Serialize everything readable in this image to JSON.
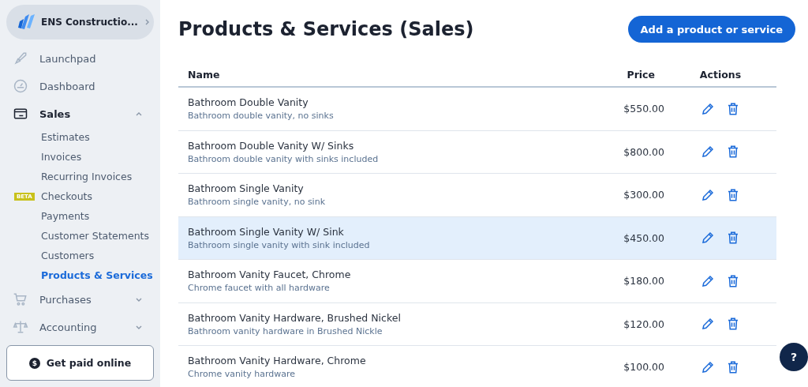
{
  "company": {
    "name": "ENS Constructio..."
  },
  "nav": [
    {
      "label": "Launchpad"
    },
    {
      "label": "Dashboard"
    },
    {
      "label": "Sales",
      "expanded": true,
      "children": [
        {
          "label": "Estimates",
          "selected": false
        },
        {
          "label": "Invoices",
          "selected": false
        },
        {
          "label": "Recurring Invoices",
          "selected": false
        },
        {
          "label": "Checkouts",
          "selected": false,
          "badge": "BETA"
        },
        {
          "label": "Payments",
          "selected": false
        },
        {
          "label": "Customer Statements",
          "selected": false
        },
        {
          "label": "Customers",
          "selected": false
        },
        {
          "label": "Products & Services",
          "selected": true
        }
      ]
    },
    {
      "label": "Purchases",
      "expanded": false
    },
    {
      "label": "Accounting",
      "expanded": false
    }
  ],
  "get_paid": {
    "label": "Get paid online",
    "icon": "$"
  },
  "title": "Products & Services (Sales)",
  "add_button": "Add a product or service",
  "table": {
    "columns": [
      "Name",
      "Price",
      "Actions"
    ],
    "rows": [
      {
        "name": "Bathroom Double Vanity",
        "description": "Bathroom double vanity, no sinks",
        "price": "$550.00",
        "selected": false
      },
      {
        "name": "Bathroom Double Vanity W/ Sinks",
        "description": "Bathroom double vanity with sinks included",
        "price": "$800.00",
        "selected": false
      },
      {
        "name": "Bathroom Single Vanity",
        "description": "Bathroom single vanity, no sink",
        "price": "$300.00",
        "selected": false
      },
      {
        "name": "Bathroom Single Vanity W/ Sink",
        "description": "Bathroom single vanity with sink included",
        "price": "$450.00",
        "selected": true
      },
      {
        "name": "Bathroom Vanity Faucet, Chrome",
        "description": "Chrome faucet with all hardware",
        "price": "$180.00",
        "selected": false
      },
      {
        "name": "Bathroom Vanity Hardware, Brushed Nickel",
        "description": "Bathroom vanity hardware in Brushed Nickle",
        "price": "$120.00",
        "selected": false
      },
      {
        "name": "Bathroom Vanity Hardware, Chrome",
        "description": "Chrome vanity hardware",
        "price": "$100.00",
        "selected": false
      }
    ]
  },
  "help": {
    "label": "?"
  }
}
